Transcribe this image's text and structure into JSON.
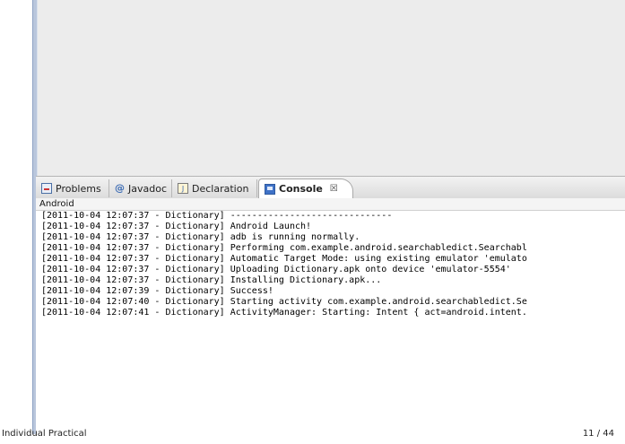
{
  "tabs": [
    {
      "label": "Problems",
      "icon": "problems-icon",
      "active": false
    },
    {
      "label": "Javadoc",
      "icon": "javadoc-icon",
      "active": false
    },
    {
      "label": "Declaration",
      "icon": "declaration-icon",
      "active": false
    },
    {
      "label": "Console",
      "icon": "console-icon",
      "active": true,
      "close": "☒"
    }
  ],
  "console": {
    "title": "Android",
    "lines": [
      "[2011-10-04 12:07:37 - Dictionary] ------------------------------",
      "[2011-10-04 12:07:37 - Dictionary] Android Launch!",
      "[2011-10-04 12:07:37 - Dictionary] adb is running normally.",
      "[2011-10-04 12:07:37 - Dictionary] Performing com.example.android.searchabledict.Searchabl",
      "[2011-10-04 12:07:37 - Dictionary] Automatic Target Mode: using existing emulator 'emulato",
      "[2011-10-04 12:07:37 - Dictionary] Uploading Dictionary.apk onto device 'emulator-5554'",
      "[2011-10-04 12:07:37 - Dictionary] Installing Dictionary.apk...",
      "[2011-10-04 12:07:39 - Dictionary] Success!",
      "[2011-10-04 12:07:40 - Dictionary] Starting activity com.example.android.searchabledict.Se",
      "[2011-10-04 12:07:41 - Dictionary] ActivityManager: Starting: Intent { act=android.intent."
    ]
  },
  "footer": {
    "left": "Individual Practical",
    "right": "11 / 44"
  }
}
